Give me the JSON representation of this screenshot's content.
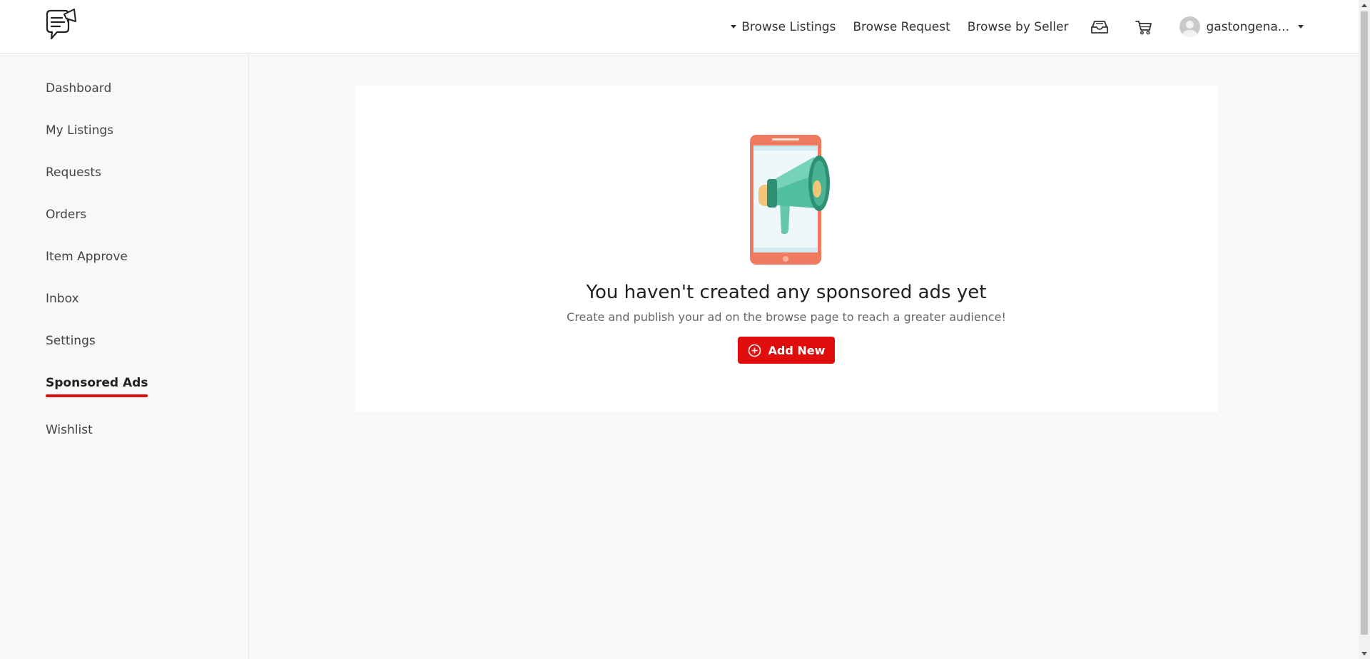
{
  "header": {
    "logo_icon": "chat-megaphone-logo",
    "nav": {
      "browse_listings": "Browse Listings",
      "browse_request": "Browse Request",
      "browse_by_seller": "Browse by Seller"
    },
    "icons": [
      "inbox-tray-icon",
      "cart-icon"
    ],
    "user": {
      "name": "gastongena..."
    }
  },
  "sidebar": {
    "items": [
      {
        "label": "Dashboard"
      },
      {
        "label": "My Listings"
      },
      {
        "label": "Requests"
      },
      {
        "label": "Orders"
      },
      {
        "label": "Item Approve"
      },
      {
        "label": "Inbox"
      },
      {
        "label": "Settings"
      },
      {
        "label": "Sponsored Ads",
        "active": true
      },
      {
        "label": "Wishlist"
      }
    ]
  },
  "main": {
    "empty_state": {
      "illustration": "phone-megaphone-illustration",
      "title": "You haven't created any sponsored ads yet",
      "subtitle": "Create and publish your ad on the browse page to reach a greater audience!",
      "button_label": "Add New"
    }
  },
  "colors": {
    "accent": "#e00d0d",
    "phone": "#f07a5f",
    "megaphone": "#4fbf9f"
  }
}
